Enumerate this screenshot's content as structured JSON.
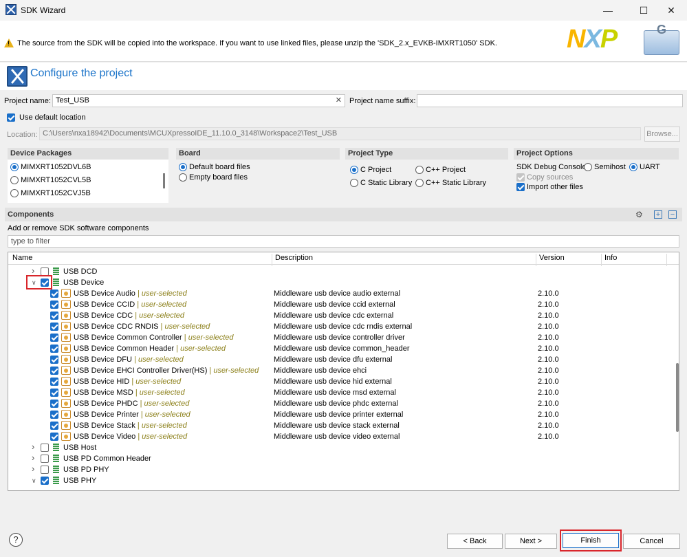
{
  "window": {
    "title": "SDK Wizard",
    "minimize_icon": "minimize-icon",
    "maximize_icon": "maximize-icon",
    "close_icon": "close-icon"
  },
  "banner": {
    "message": "The source from the SDK will be copied into the workspace. If you want to use linked files, please unzip the 'SDK_2.x_EVKB-IMXRT1050' SDK.",
    "logo_n": "N",
    "logo_x": "X",
    "logo_p": "P",
    "badge": "G"
  },
  "header": {
    "title": "Configure the project"
  },
  "project": {
    "name_label": "Project name:",
    "name_value": "Test_USB",
    "suffix_label": "Project name suffix:",
    "suffix_value": "",
    "use_default_location_label": "Use default location",
    "location_label": "Location:",
    "location_value": "C:\\Users\\nxa18942\\Documents\\MCUXpressoIDE_11.10.0_3148\\Workspace2\\Test_USB",
    "browse_label": "Browse..."
  },
  "device_packages": {
    "title": "Device Packages",
    "items": [
      "MIMXRT1052DVL6B",
      "MIMXRT1052CVL5B",
      "MIMXRT1052CVJ5B"
    ]
  },
  "board": {
    "title": "Board",
    "options": [
      "Default board files",
      "Empty board files"
    ]
  },
  "project_type": {
    "title": "Project Type",
    "options": [
      "C Project",
      "C++ Project",
      "C Static Library",
      "C++ Static Library"
    ]
  },
  "project_options": {
    "title": "Project Options",
    "sdk_debug_console_label": "SDK Debug Console",
    "semihost_label": "Semihost",
    "uart_label": "UART",
    "copy_sources_label": "Copy sources",
    "import_other_files_label": "Import other files"
  },
  "components": {
    "title": "Components",
    "subtitle": "Add or remove SDK software components",
    "filter_placeholder": "type to filter",
    "columns": [
      "Name",
      "Description",
      "Version",
      "Info"
    ],
    "user_selected_tag": "user-selected",
    "rows": [
      {
        "name": "USB DCD",
        "level": 0,
        "expanded": false,
        "checked": false,
        "description": "",
        "version": ""
      },
      {
        "name": "USB Device",
        "level": 0,
        "expanded": true,
        "checked": true,
        "description": "",
        "version": ""
      },
      {
        "name": "USB Device Audio",
        "level": 1,
        "checked": true,
        "tag": "user-selected",
        "description": "Middleware usb device audio external",
        "version": "2.10.0"
      },
      {
        "name": "USB Device CCID",
        "level": 1,
        "checked": true,
        "tag": "user-selected",
        "description": "Middleware usb device ccid external",
        "version": "2.10.0"
      },
      {
        "name": "USB Device CDC",
        "level": 1,
        "checked": true,
        "tag": "user-selected",
        "description": "Middleware usb device cdc external",
        "version": "2.10.0"
      },
      {
        "name": "USB Device CDC RNDIS",
        "level": 1,
        "checked": true,
        "tag": "user-selected",
        "description": "Middleware usb device cdc rndis external",
        "version": "2.10.0"
      },
      {
        "name": "USB Device Common Controller",
        "level": 1,
        "checked": true,
        "tag": "user-selected",
        "description": "Middleware usb device controller driver",
        "version": "2.10.0"
      },
      {
        "name": "USB Device Common Header",
        "level": 1,
        "checked": true,
        "tag": "user-selected",
        "description": "Middleware usb device common_header",
        "version": "2.10.0"
      },
      {
        "name": "USB Device DFU",
        "level": 1,
        "checked": true,
        "tag": "user-selected",
        "description": "Middleware usb device dfu external",
        "version": "2.10.0"
      },
      {
        "name": "USB Device EHCI Controller Driver(HS)",
        "level": 1,
        "checked": true,
        "tag": "user-selected",
        "description": "Middleware usb device ehci",
        "version": "2.10.0"
      },
      {
        "name": "USB Device HID",
        "level": 1,
        "checked": true,
        "tag": "user-selected",
        "description": "Middleware usb device hid external",
        "version": "2.10.0"
      },
      {
        "name": "USB Device MSD",
        "level": 1,
        "checked": true,
        "tag": "user-selected",
        "description": "Middleware usb device msd external",
        "version": "2.10.0"
      },
      {
        "name": "USB Device PHDC",
        "level": 1,
        "checked": true,
        "tag": "user-selected",
        "description": "Middleware usb device phdc external",
        "version": "2.10.0"
      },
      {
        "name": "USB Device Printer",
        "level": 1,
        "checked": true,
        "tag": "user-selected",
        "description": "Middleware usb device printer external",
        "version": "2.10.0"
      },
      {
        "name": "USB Device Stack",
        "level": 1,
        "checked": true,
        "tag": "user-selected",
        "description": "Middleware usb device stack external",
        "version": "2.10.0"
      },
      {
        "name": "USB Device Video",
        "level": 1,
        "checked": true,
        "tag": "user-selected",
        "description": "Middleware usb device video external",
        "version": "2.10.0"
      },
      {
        "name": "USB Host",
        "level": 0,
        "expanded": false,
        "checked": false,
        "description": "",
        "version": ""
      },
      {
        "name": "USB PD Common Header",
        "level": 0,
        "expanded": false,
        "checked": false,
        "description": "",
        "version": ""
      },
      {
        "name": "USB PD PHY",
        "level": 0,
        "expanded": false,
        "checked": false,
        "description": "",
        "version": ""
      },
      {
        "name": "USB PHY",
        "level": 0,
        "expanded": true,
        "checked": true,
        "description": "",
        "version": ""
      }
    ]
  },
  "footer": {
    "help_label": "?",
    "back_label": "< Back",
    "next_label": "Next >",
    "finish_label": "Finish",
    "cancel_label": "Cancel"
  }
}
